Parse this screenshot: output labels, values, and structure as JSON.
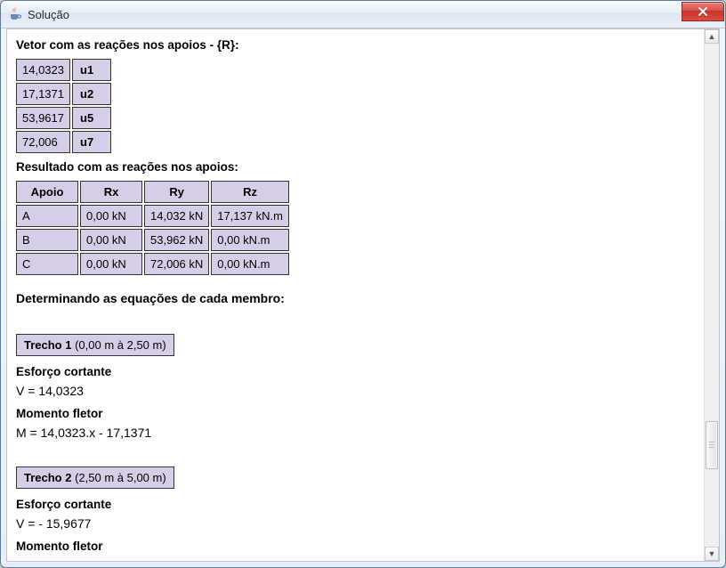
{
  "window": {
    "title": "Solução"
  },
  "headings": {
    "vetor": "Vetor com as reações nos apoios - {R}:",
    "resultado": "Resultado com as reações nos apoios:",
    "equacoes": "Determinando as equações de cada membro:",
    "esforco": "Esforço cortante",
    "momento": "Momento fletor"
  },
  "vetorR": [
    {
      "value": "14,0323",
      "label": "u1"
    },
    {
      "value": "17,1371",
      "label": "u2"
    },
    {
      "value": "53,9617",
      "label": "u5"
    },
    {
      "value": "72,006",
      "label": "u7"
    }
  ],
  "resultTable": {
    "headers": {
      "apoio": "Apoio",
      "rx": "Rx",
      "ry": "Ry",
      "rz": "Rz"
    },
    "rows": [
      {
        "apoio": "A",
        "rx": "0,00 kN",
        "ry": "14,032 kN",
        "rz": "17,137 kN.m"
      },
      {
        "apoio": "B",
        "rx": "0,00 kN",
        "ry": "53,962 kN",
        "rz": "0,00 kN.m"
      },
      {
        "apoio": "C",
        "rx": "0,00 kN",
        "ry": "72,006 kN",
        "rz": "0,00 kN.m"
      }
    ]
  },
  "trechos": [
    {
      "title_bold": "Trecho 1",
      "title_rest": " (0,00 m à 2,50 m)",
      "v_eq": "V = 14,0323",
      "m_eq": "M = 14,0323.x - 17,1371"
    },
    {
      "title_bold": "Trecho 2",
      "title_rest": " (2,50 m à 5,00 m)",
      "v_eq": "V = - 15,9677",
      "m_eq": ""
    }
  ]
}
